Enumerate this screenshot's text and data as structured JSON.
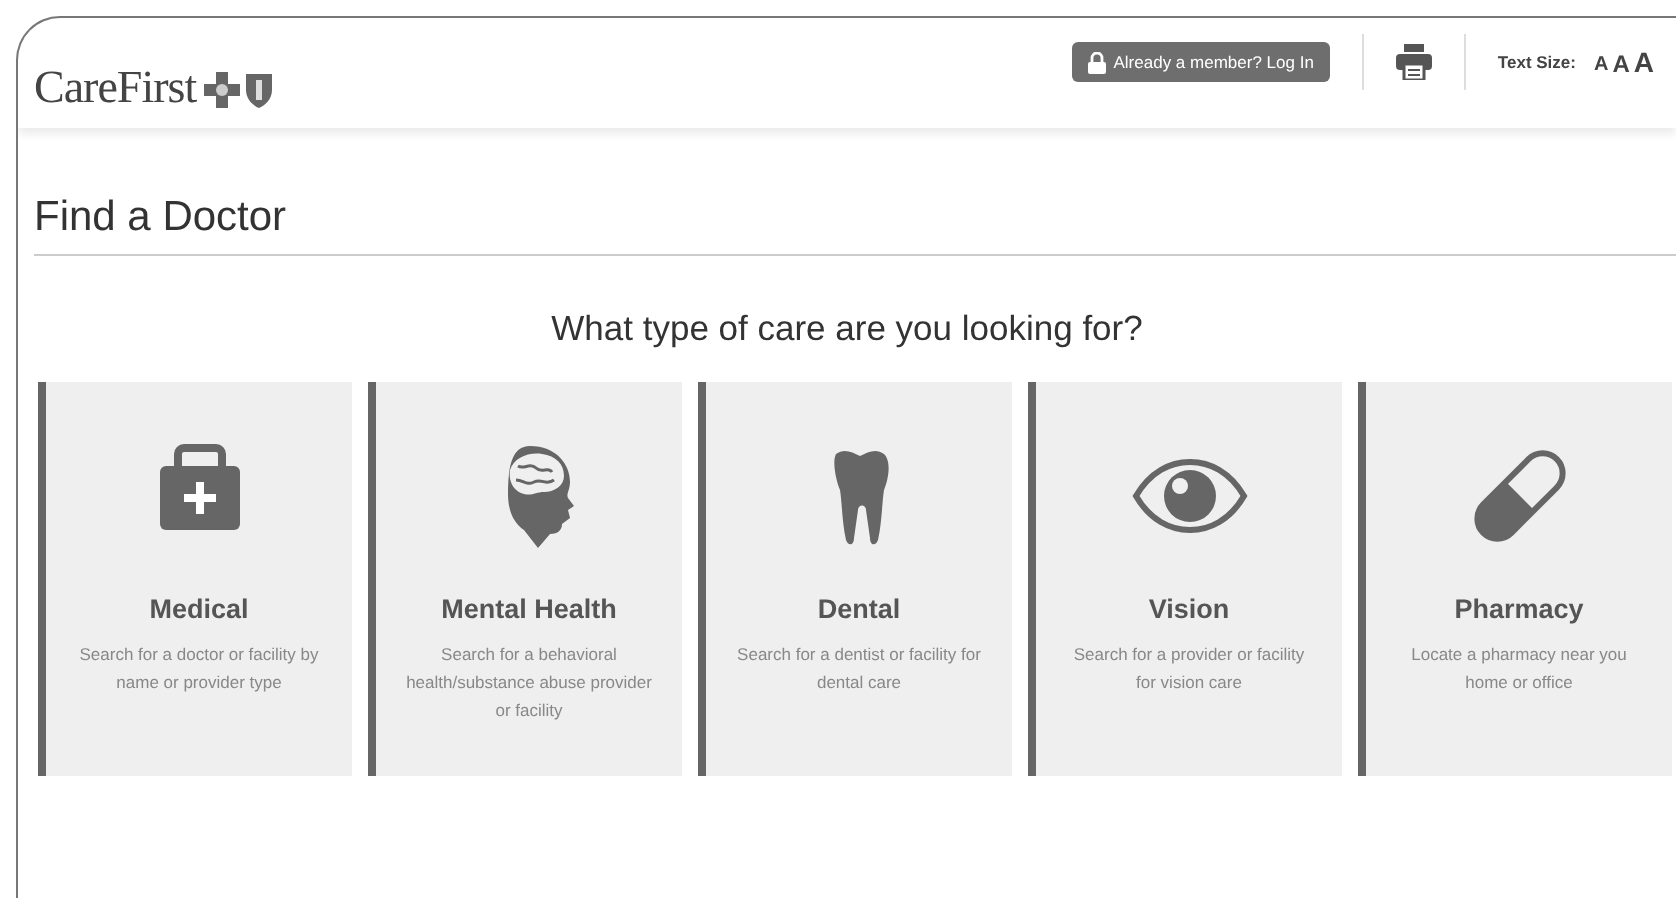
{
  "header": {
    "logo": "CareFirst",
    "login_button": "Already a member? Log In",
    "text_size_label": "Text Size:",
    "text_size_options": [
      "A",
      "A",
      "A"
    ]
  },
  "page_title": "Find a Doctor",
  "question": "What type of care are you looking for?",
  "care_types": [
    {
      "kind": "medical",
      "title": "Medical",
      "description": "Search for a doctor or facility by name or provider type"
    },
    {
      "kind": "mental",
      "title": "Mental Health",
      "description": "Search for a behavioral health/substance abuse provider or facility"
    },
    {
      "kind": "dental",
      "title": "Dental",
      "description": "Search for a dentist or facility for dental care"
    },
    {
      "kind": "vision",
      "title": "Vision",
      "description": "Search for a provider or facility for vision care"
    },
    {
      "kind": "pharmacy",
      "title": "Pharmacy",
      "description": "Locate a pharmacy near you home or office"
    }
  ]
}
